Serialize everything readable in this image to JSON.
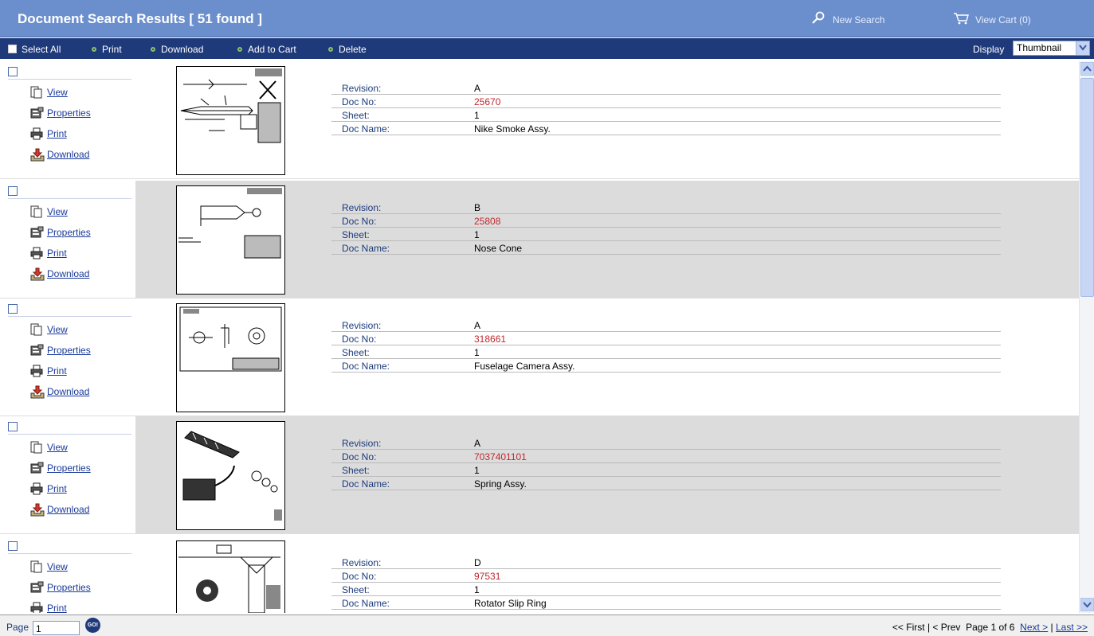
{
  "header": {
    "title": "Document Search Results [ 51 found ]",
    "new_search": "New Search",
    "view_cart": "View Cart (0)"
  },
  "toolbar": {
    "select_all": "Select All",
    "print": "Print",
    "download": "Download",
    "add_to_cart": "Add to Cart",
    "delete": "Delete",
    "display_label": "Display",
    "display_value": "Thumbnail"
  },
  "actions": {
    "view": "View",
    "properties": "Properties",
    "print": "Print",
    "download": "Download"
  },
  "field_labels": {
    "revision": "Revision:",
    "doc_no": "Doc No:",
    "sheet": "Sheet:",
    "doc_name": "Doc Name:"
  },
  "results": [
    {
      "revision": "A",
      "doc_no": "25670",
      "sheet": "1",
      "doc_name": "Nike Smoke Assy."
    },
    {
      "revision": "B",
      "doc_no": "25808",
      "sheet": "1",
      "doc_name": "Nose Cone"
    },
    {
      "revision": "A",
      "doc_no": "318661",
      "sheet": "1",
      "doc_name": "Fuselage Camera Assy."
    },
    {
      "revision": "A",
      "doc_no": "7037401101",
      "sheet": "1",
      "doc_name": "Spring Assy."
    },
    {
      "revision": "D",
      "doc_no": "97531",
      "sheet": "1",
      "doc_name": "Rotator Slip Ring"
    }
  ],
  "footer": {
    "page_label": "Page",
    "page_value": "1",
    "go": "GO!",
    "first": "<< First",
    "sep1": " | ",
    "prev": "< Prev",
    "page_info": "Page 1 of 6",
    "next": "Next >",
    "sep2": " | ",
    "last": "Last >>"
  },
  "colors": {
    "header_bg": "#6b8fcc",
    "toolbar_bg": "#1f3a7a",
    "alt_row_bg": "#dcdcdc",
    "doc_no_color": "#c0282d",
    "link_color": "#1a3a9a"
  }
}
